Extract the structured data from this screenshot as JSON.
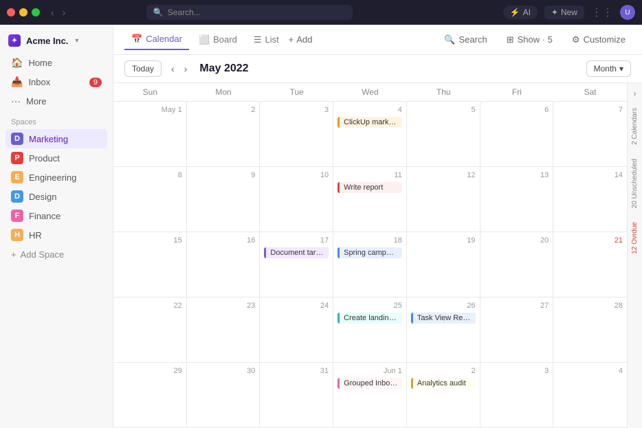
{
  "titlebar": {
    "search_placeholder": "Search...",
    "ai_label": "AI",
    "new_label": "New"
  },
  "sidebar": {
    "org_name": "Acme Inc.",
    "nav_items": [
      {
        "id": "home",
        "label": "Home",
        "icon": "🏠"
      },
      {
        "id": "inbox",
        "label": "Inbox",
        "icon": "📥",
        "badge": "9"
      },
      {
        "id": "more",
        "label": "More",
        "icon": "•••"
      }
    ],
    "spaces_label": "Spaces",
    "spaces": [
      {
        "id": "marketing",
        "label": "Marketing",
        "initial": "D",
        "color": "space-icon-d",
        "active": true
      },
      {
        "id": "product",
        "label": "Product",
        "initial": "P",
        "color": "space-icon-p"
      },
      {
        "id": "engineering",
        "label": "Engineering",
        "initial": "E",
        "color": "space-icon-e"
      },
      {
        "id": "design",
        "label": "Design",
        "initial": "D",
        "color": "space-icon-d2"
      },
      {
        "id": "finance",
        "label": "Finance",
        "initial": "F",
        "color": "space-icon-f"
      },
      {
        "id": "hr",
        "label": "HR",
        "initial": "H",
        "color": "space-icon-h"
      }
    ],
    "add_space_label": "Add Space"
  },
  "topnav": {
    "tabs": [
      {
        "id": "calendar",
        "label": "Calendar",
        "icon": "📅",
        "active": true
      },
      {
        "id": "board",
        "label": "Board",
        "icon": "⬜"
      },
      {
        "id": "list",
        "label": "List",
        "icon": "☰"
      }
    ],
    "add_label": "Add",
    "search_label": "Search",
    "show_label": "Show · 5",
    "customize_label": "Customize"
  },
  "calendar": {
    "today_label": "Today",
    "month_label": "Month",
    "title": "May 2022",
    "day_headers": [
      "Sun",
      "Mon",
      "Tue",
      "Wed",
      "Thu",
      "Fri",
      "Sat"
    ],
    "weeks": [
      {
        "days": [
          {
            "date": "May 1",
            "events": []
          },
          {
            "date": "2",
            "events": []
          },
          {
            "date": "3",
            "events": []
          },
          {
            "date": "4",
            "events": [
              {
                "label": "ClickUp marketing plan",
                "style": "event-orange"
              }
            ]
          },
          {
            "date": "5",
            "events": []
          },
          {
            "date": "6",
            "events": []
          },
          {
            "date": "7",
            "events": []
          }
        ]
      },
      {
        "days": [
          {
            "date": "8",
            "events": []
          },
          {
            "date": "9",
            "events": []
          },
          {
            "date": "10",
            "events": []
          },
          {
            "date": "11",
            "events": [
              {
                "label": "Write report",
                "style": "event-red"
              }
            ]
          },
          {
            "date": "12",
            "events": []
          },
          {
            "date": "13",
            "events": []
          },
          {
            "date": "14",
            "events": []
          }
        ]
      },
      {
        "days": [
          {
            "date": "15",
            "events": []
          },
          {
            "date": "16",
            "events": []
          },
          {
            "date": "17",
            "events": [
              {
                "label": "Document target users",
                "style": "event-purple"
              }
            ]
          },
          {
            "date": "18",
            "events": [
              {
                "label": "Spring campaign image assets",
                "style": "event-blue"
              }
            ]
          },
          {
            "date": "19",
            "events": []
          },
          {
            "date": "20",
            "events": []
          },
          {
            "date": "21",
            "events": [],
            "sat_overdue": true
          }
        ]
      },
      {
        "days": [
          {
            "date": "22",
            "events": []
          },
          {
            "date": "23",
            "events": []
          },
          {
            "date": "24",
            "events": []
          },
          {
            "date": "25",
            "events": [
              {
                "label": "Create landing page",
                "style": "event-teal"
              }
            ]
          },
          {
            "date": "26",
            "events": [
              {
                "label": "Task View Redesign",
                "style": "event-blue"
              }
            ]
          },
          {
            "date": "27",
            "events": []
          },
          {
            "date": "28",
            "events": []
          }
        ]
      },
      {
        "days": [
          {
            "date": "29",
            "events": []
          },
          {
            "date": "30",
            "events": []
          },
          {
            "date": "31",
            "events": []
          },
          {
            "date": "Jun 1",
            "events": [
              {
                "label": "Grouped Inbox Comments",
                "style": "event-pink"
              }
            ]
          },
          {
            "date": "2",
            "events": [
              {
                "label": "Analytics audit",
                "style": "event-yellow"
              }
            ]
          },
          {
            "date": "3",
            "events": []
          },
          {
            "date": "4",
            "events": []
          }
        ]
      }
    ]
  },
  "right_sidebar": {
    "toggle_icon": "›",
    "tabs": [
      {
        "id": "calendars",
        "label": "2 Calendars"
      },
      {
        "id": "unscheduled",
        "label": "20 Unscheduled"
      },
      {
        "id": "overdue",
        "label": "12 Ovrdue",
        "overdue": true
      }
    ]
  }
}
